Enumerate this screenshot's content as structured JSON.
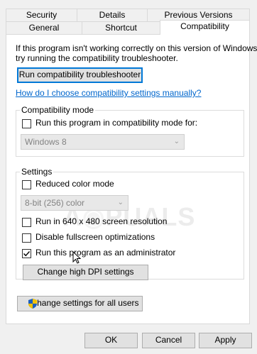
{
  "tabs_top": [
    "Security",
    "Details",
    "Previous Versions"
  ],
  "tabs_bottom": [
    "General",
    "Shortcut",
    "Compatibility"
  ],
  "intro_text_1": "If this program isn't working correctly on this version of Windows,",
  "intro_text_2": "try running the compatibility troubleshooter.",
  "troubleshooter_button": "Run compatibility troubleshooter",
  "manual_link": "How do I choose compatibility settings manually?",
  "compat_mode": {
    "label": "Compatibility mode",
    "checkbox_label": "Run this program in compatibility mode for:",
    "checked": false,
    "select_value": "Windows 8"
  },
  "settings": {
    "label": "Settings",
    "reduced_color": {
      "label": "Reduced color mode",
      "checked": false
    },
    "color_select_value": "8-bit (256) color",
    "res_640": {
      "label": "Run in 640 x 480 screen resolution",
      "checked": false
    },
    "disable_fullscreen": {
      "label": "Disable fullscreen optimizations",
      "checked": false
    },
    "run_as_admin": {
      "label": "Run this program as an administrator",
      "checked": true
    },
    "dpi_button": "Change high DPI settings"
  },
  "all_users_button": "Change settings for all users",
  "footer": {
    "ok": "OK",
    "cancel": "Cancel",
    "apply": "Apply"
  },
  "watermark": "APPUALS",
  "colors": {
    "link": "#0066cc",
    "focus": "#0078d7",
    "shield_blue": "#1d5fbf",
    "shield_yellow": "#f2c200"
  }
}
